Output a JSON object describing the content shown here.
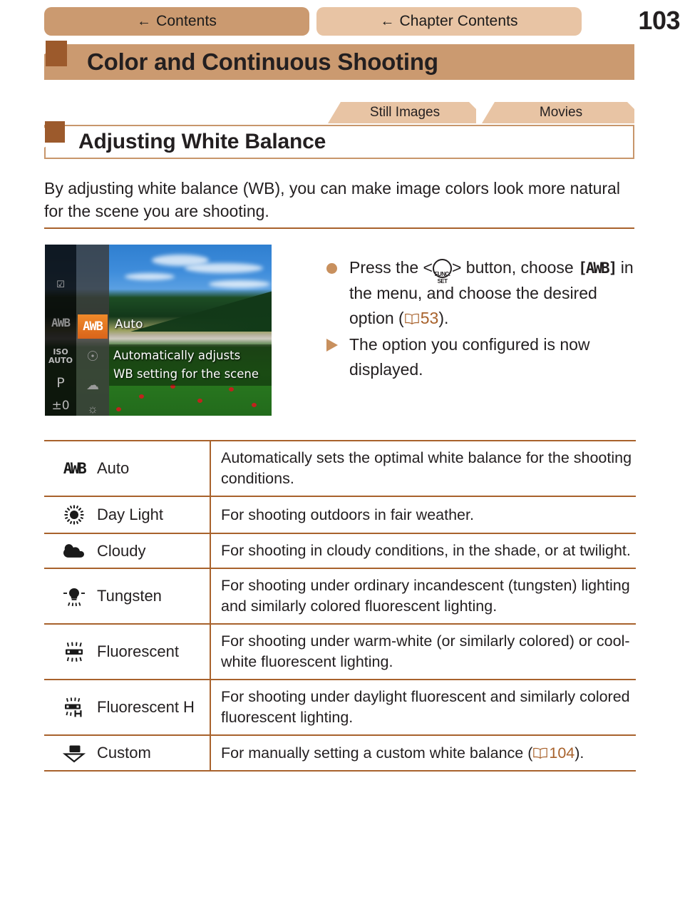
{
  "page": {
    "number": "103",
    "accent_tan": "#cb9a70",
    "accent_light_tan": "#e8c4a4",
    "accent_brown": "#a8622c",
    "accent_dark_brown": "#9c5a2c"
  },
  "topnav": {
    "contents_label": "Contents",
    "chapter_contents_label": "Chapter Contents",
    "back_arrow": "←"
  },
  "chapter": {
    "title": "Color and Continuous Shooting"
  },
  "mode_tabs": [
    {
      "label": "Still Images"
    },
    {
      "label": "Movies"
    }
  ],
  "section": {
    "title": "Adjusting White Balance",
    "intro": "By adjusting white balance (WB), you can make image colors look more natural for the scene you are shooting."
  },
  "camera_screen": {
    "selected_mode": "AWB",
    "option_label": "Auto",
    "description_line1": "Automatically adjusts",
    "description_line2": "WB setting for the scene",
    "left_column_items": [
      "ISO\nAUTO",
      "P",
      "±0"
    ],
    "dim_awb": "AWB"
  },
  "steps": [
    {
      "marker": "bullet",
      "text_before_button": "Press the <",
      "button_line1": "FUNC.",
      "button_line2": "SET",
      "text_after_button": "> button, choose",
      "bracket_tag": "[AWB]",
      "text_line2_rest": " in the menu, and choose",
      "text_line3": "the desired option (",
      "page_ref": "53",
      "text_line3_end": ")."
    },
    {
      "marker": "triangle",
      "text": "The option you configured is now displayed."
    }
  ],
  "wb_table": {
    "rows": [
      {
        "icon": "awb-icon",
        "icon_text": "AWB",
        "name": "Auto",
        "description": "Automatically sets the optimal white balance for the shooting conditions."
      },
      {
        "icon": "daylight-sun-icon",
        "name": "Day Light",
        "description": "For shooting outdoors in fair weather."
      },
      {
        "icon": "cloudy-cloud-icon",
        "name": "Cloudy",
        "description": "For shooting in cloudy conditions, in the shade, or at twilight."
      },
      {
        "icon": "tungsten-bulb-icon",
        "name": "Tungsten",
        "description": "For shooting under ordinary incandescent (tungsten) lighting and similarly colored fluorescent lighting."
      },
      {
        "icon": "fluorescent-tube-icon",
        "name": "Fluorescent",
        "description": "For shooting under warm-white (or similarly colored) or cool-white fluorescent lighting."
      },
      {
        "icon": "fluorescent-h-icon",
        "name": "Fluorescent H",
        "description": "For shooting under daylight fluorescent and similarly colored fluorescent lighting."
      },
      {
        "icon": "custom-wb-icon",
        "name": "Custom",
        "description_before_ref": "For manually setting a custom white balance (",
        "page_ref": "104",
        "description_after_ref": ")."
      }
    ]
  }
}
